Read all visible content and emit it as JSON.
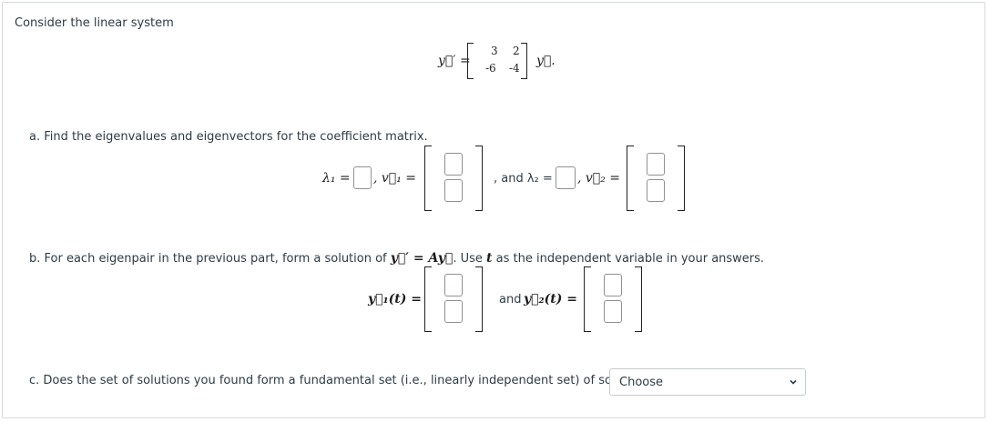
{
  "intro": "Consider the linear system",
  "system": {
    "lhs": "y⃗′ =",
    "matrix": [
      [
        "3",
        "2"
      ],
      [
        "-6",
        "-4"
      ]
    ],
    "rhs": "y⃗."
  },
  "part_a": {
    "prompt": "a. Find the eigenvalues and eigenvectors for the coefficient matrix.",
    "lambda1_label": "λ₁ =",
    "v1_label": ", v⃗₁ =",
    "and_lambda2_label": ", and λ₂ =",
    "v2_label": ", v⃗₂ ="
  },
  "part_b": {
    "prompt_before": "b. For each eigenpair in the previous part, form a solution of",
    "eq_math": "y⃗′ = Ay⃗",
    "prompt_mid": ". Use",
    "t_var": "t",
    "prompt_after": "as the independent variable in your answers.",
    "y1_label": "y⃗₁(t) =",
    "and_label": "and",
    "y2_label": "y⃗₂(t) ="
  },
  "part_c": {
    "prompt": "c. Does the set of solutions you found form a fundamental set (i.e., linearly independent set) of solutions?",
    "select_value": "Choose"
  }
}
